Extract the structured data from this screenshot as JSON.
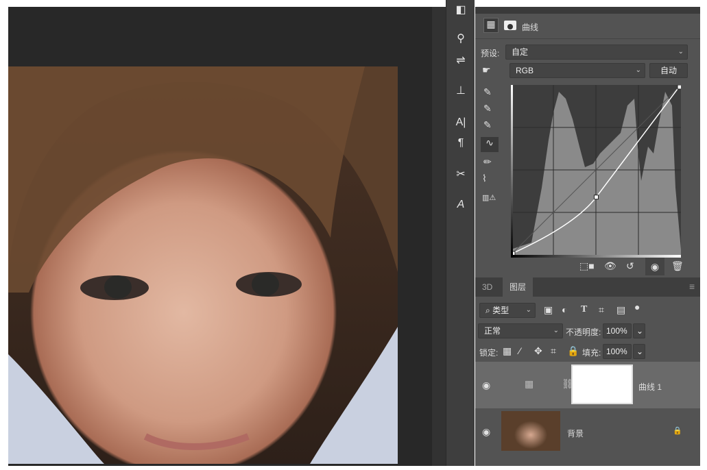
{
  "properties": {
    "title": "曲线",
    "preset_label": "预设:",
    "preset_value": "自定",
    "channel": "RGB",
    "auto_button": "自动"
  },
  "layers_panel": {
    "tabs": [
      {
        "label": "3D"
      },
      {
        "label": "图层"
      }
    ],
    "filter_kind": "类型",
    "blend_mode": "正常",
    "opacity_label": "不透明度:",
    "opacity": "100%",
    "lock_label": "锁定:",
    "fill_label": "填充:",
    "fill": "100%",
    "layers": [
      {
        "name": "曲线 1",
        "visible": true
      },
      {
        "name": "背景",
        "visible": true,
        "locked": true
      }
    ]
  },
  "curve": {
    "points": [
      [
        0,
        0
      ],
      [
        128,
        86
      ],
      [
        255,
        255
      ]
    ]
  },
  "colors": {
    "panel": "#535353",
    "canvas": "#282828"
  }
}
